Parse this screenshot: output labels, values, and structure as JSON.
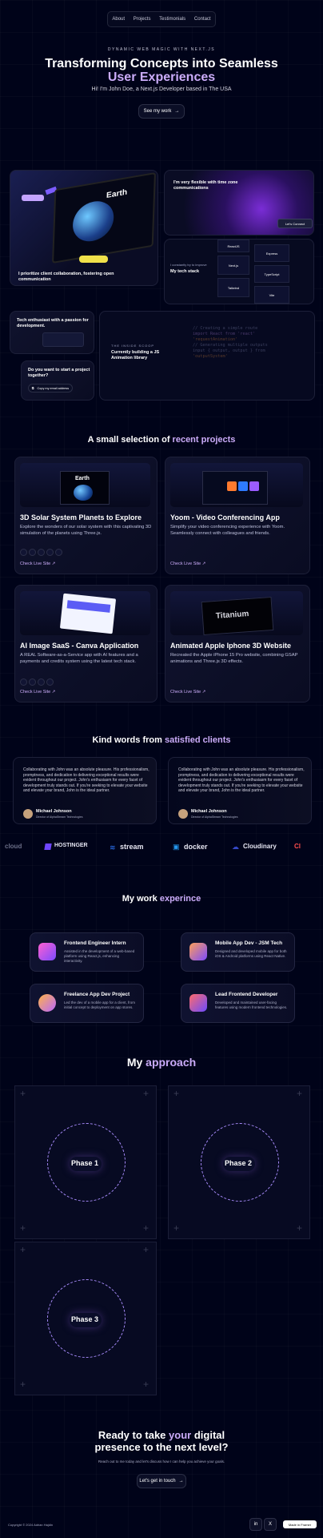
{
  "nav": {
    "items": [
      "About",
      "Projects",
      "Testimonials",
      "Contact"
    ]
  },
  "hero": {
    "eyebrow": "DYNAMIC WEB MAGIC WITH NEXT.JS",
    "title_line1": "Transforming Concepts into Seamless",
    "title_line2": "User Experiences",
    "subtitle": "Hi! I'm John Doe, a Next.js Developer based in The USA",
    "cta": "See my work"
  },
  "grid": {
    "card1_text": "I prioritize client collaboration, fostering open communication",
    "card1_screen_word": "Earth",
    "card2_text": "I'm very flexible with time zone communications",
    "card2_time": "Let's Connect",
    "card3_eyebrow": "I constantly try to improve",
    "card3_text": "My tech stack",
    "stack_left": [
      "ReactJS",
      "Next.js",
      "Tailwind"
    ],
    "stack_right": [
      "Express",
      "TypeScript",
      "MongoDB",
      "Vite"
    ],
    "card4_text": "Tech enthusiast with a passion for development.",
    "card5_eyebrow": "THE INSIDE SCOOP",
    "card5_text": "Currently building a JS Animation library",
    "card6_text": "Do you want to start a project together?",
    "card6_btn": "Copy my email address",
    "code_lines": [
      "// Creating a simple route",
      "import React from 'react'",
      "'requestAnimation'",
      "",
      "// Generating multiple outputs",
      "input { output, output } from",
      "'outputSystem'"
    ]
  },
  "projects": {
    "title_pre": "A small selection of",
    "title_accent": "recent projects",
    "items": [
      {
        "title": "3D Solar System Planets to Explore",
        "desc": "Explore the wonders of our solar system with this captivating 3D simulation of the planets using Three.js.",
        "link": "Check Live Site",
        "screen": "Earth"
      },
      {
        "title": "Yoom - Video Conferencing App",
        "desc": "Simplify your video conferencing experience with Yoom. Seamlessly connect with colleagues and friends.",
        "link": "Check Live Site",
        "screen": ""
      },
      {
        "title": "AI Image SaaS - Canva Application",
        "desc": "A REAL Software-as-a-Service app with AI features and a payments and credits system using the latest tech stack.",
        "link": "Check Live Site",
        "screen": ""
      },
      {
        "title": "Animated Apple Iphone 3D Website",
        "desc": "Recreated the Apple iPhone 15 Pro website, combining GSAP animations and Three.js 3D effects.",
        "link": "Check Live Site",
        "screen": "Titanium"
      }
    ]
  },
  "testimonials": {
    "title_pre": "Kind words from",
    "title_accent": "satisfied clients",
    "items": [
      {
        "quote": "Collaborating with John was an absolute pleasure. His professionalism, promptness, and dedication to delivering exceptional results were evident throughout our project. John's enthusiasm for every facet of development truly stands out. If you're seeking to elevate your website and elevate your brand, John is the ideal partner.",
        "name": "Michael Johnson",
        "role": "Director of AlphaStream Technologies"
      },
      {
        "quote": "Collaborating with John was an absolute pleasure. His professionalism, promptness, and dedication to delivering exceptional results were evident throughout our project. John's enthusiasm for every facet of development truly stands out. If you're seeking to elevate your website and elevate your brand, John is the ideal partner.",
        "name": "Michael Johnson",
        "role": "Director of AlphaStream Technologies"
      }
    ]
  },
  "logos": [
    "cloud",
    "HOSTINGER",
    "stream",
    "docker",
    "Cloudinary",
    "Cl"
  ],
  "experience": {
    "title_pre": "My work",
    "title_accent": "experince",
    "items": [
      {
        "title": "Frontend Engineer Intern",
        "desc": "Assisted in the development of a web-based platform using React.js, enhancing interactivity."
      },
      {
        "title": "Mobile App Dev - JSM Tech",
        "desc": "Designed and developed mobile app for both iOS & Android platforms using React Native."
      },
      {
        "title": "Freelance App Dev Project",
        "desc": "Led the dev of a mobile app for a client, from initial concept to deployment on app stores."
      },
      {
        "title": "Lead Frontend Developer",
        "desc": "Developed and maintained user-facing features using modern frontend technologies."
      }
    ]
  },
  "approach": {
    "title_pre": "My",
    "title_accent": "approach",
    "phases": [
      "Phase 1",
      "Phase 2",
      "Phase 3"
    ]
  },
  "footer": {
    "title_pre": "Ready to take",
    "title_accent": "your",
    "title_post": "digital",
    "title_line2": "presence to the next level?",
    "subtitle": "Reach out to me today and let's discuss how I can help you achieve your goals.",
    "cta": "Let's get in touch",
    "copyright": "Copyright © 2024 Adrian Hajdin",
    "socials": [
      "in",
      "X",
      "ig"
    ],
    "badge": "Made in Framer"
  },
  "colors": {
    "accent": "#cbacf9",
    "bg": "#000319"
  }
}
